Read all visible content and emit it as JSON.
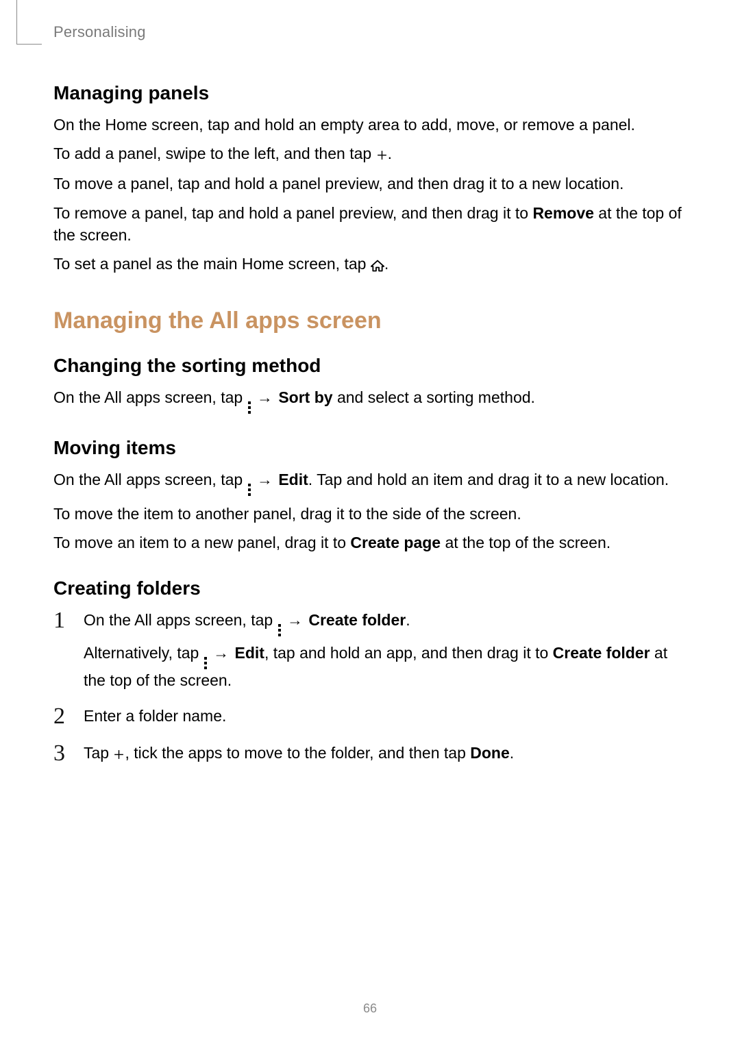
{
  "header": {
    "breadcrumb": "Personalising"
  },
  "s1": {
    "title": "Managing panels",
    "p1": "On the Home screen, tap and hold an empty area to add, move, or remove a panel.",
    "p2a": "To add a panel, swipe to the left, and then tap ",
    "p2b": ".",
    "p3": "To move a panel, tap and hold a panel preview, and then drag it to a new location.",
    "p4a": "To remove a panel, tap and hold a panel preview, and then drag it to ",
    "p4bold": "Remove",
    "p4b": " at the top of the screen.",
    "p5a": "To set a panel as the main Home screen, tap ",
    "p5b": "."
  },
  "major": {
    "title": "Managing the All apps screen"
  },
  "s2": {
    "title": "Changing the sorting method",
    "p1a": "On the All apps screen, tap ",
    "arrow": " → ",
    "p1bold": "Sort by",
    "p1b": " and select a sorting method."
  },
  "s3": {
    "title": "Moving items",
    "p1a": "On the All apps screen, tap ",
    "arrow": " → ",
    "p1bold": "Edit",
    "p1b": ". Tap and hold an item and drag it to a new location.",
    "p2": "To move the item to another panel, drag it to the side of the screen.",
    "p3a": "To move an item to a new panel, drag it to ",
    "p3bold": "Create page",
    "p3b": " at the top of the screen."
  },
  "s4": {
    "title": "Creating folders",
    "n1": "1",
    "n2": "2",
    "n3": "3",
    "i1a": "On the All apps screen, tap ",
    "arrow": " → ",
    "i1bold": "Create folder",
    "i1b": ".",
    "i1c_a": "Alternatively, tap ",
    "i1c_bold": "Edit",
    "i1c_b": ", tap and hold an app, and then drag it to ",
    "i1c_bold2": "Create folder",
    "i1c_c": " at the top of the screen.",
    "i2": "Enter a folder name.",
    "i3a": "Tap ",
    "i3b": ", tick the apps to move to the folder, and then tap ",
    "i3bold": "Done",
    "i3c": "."
  },
  "pageNumber": "66"
}
